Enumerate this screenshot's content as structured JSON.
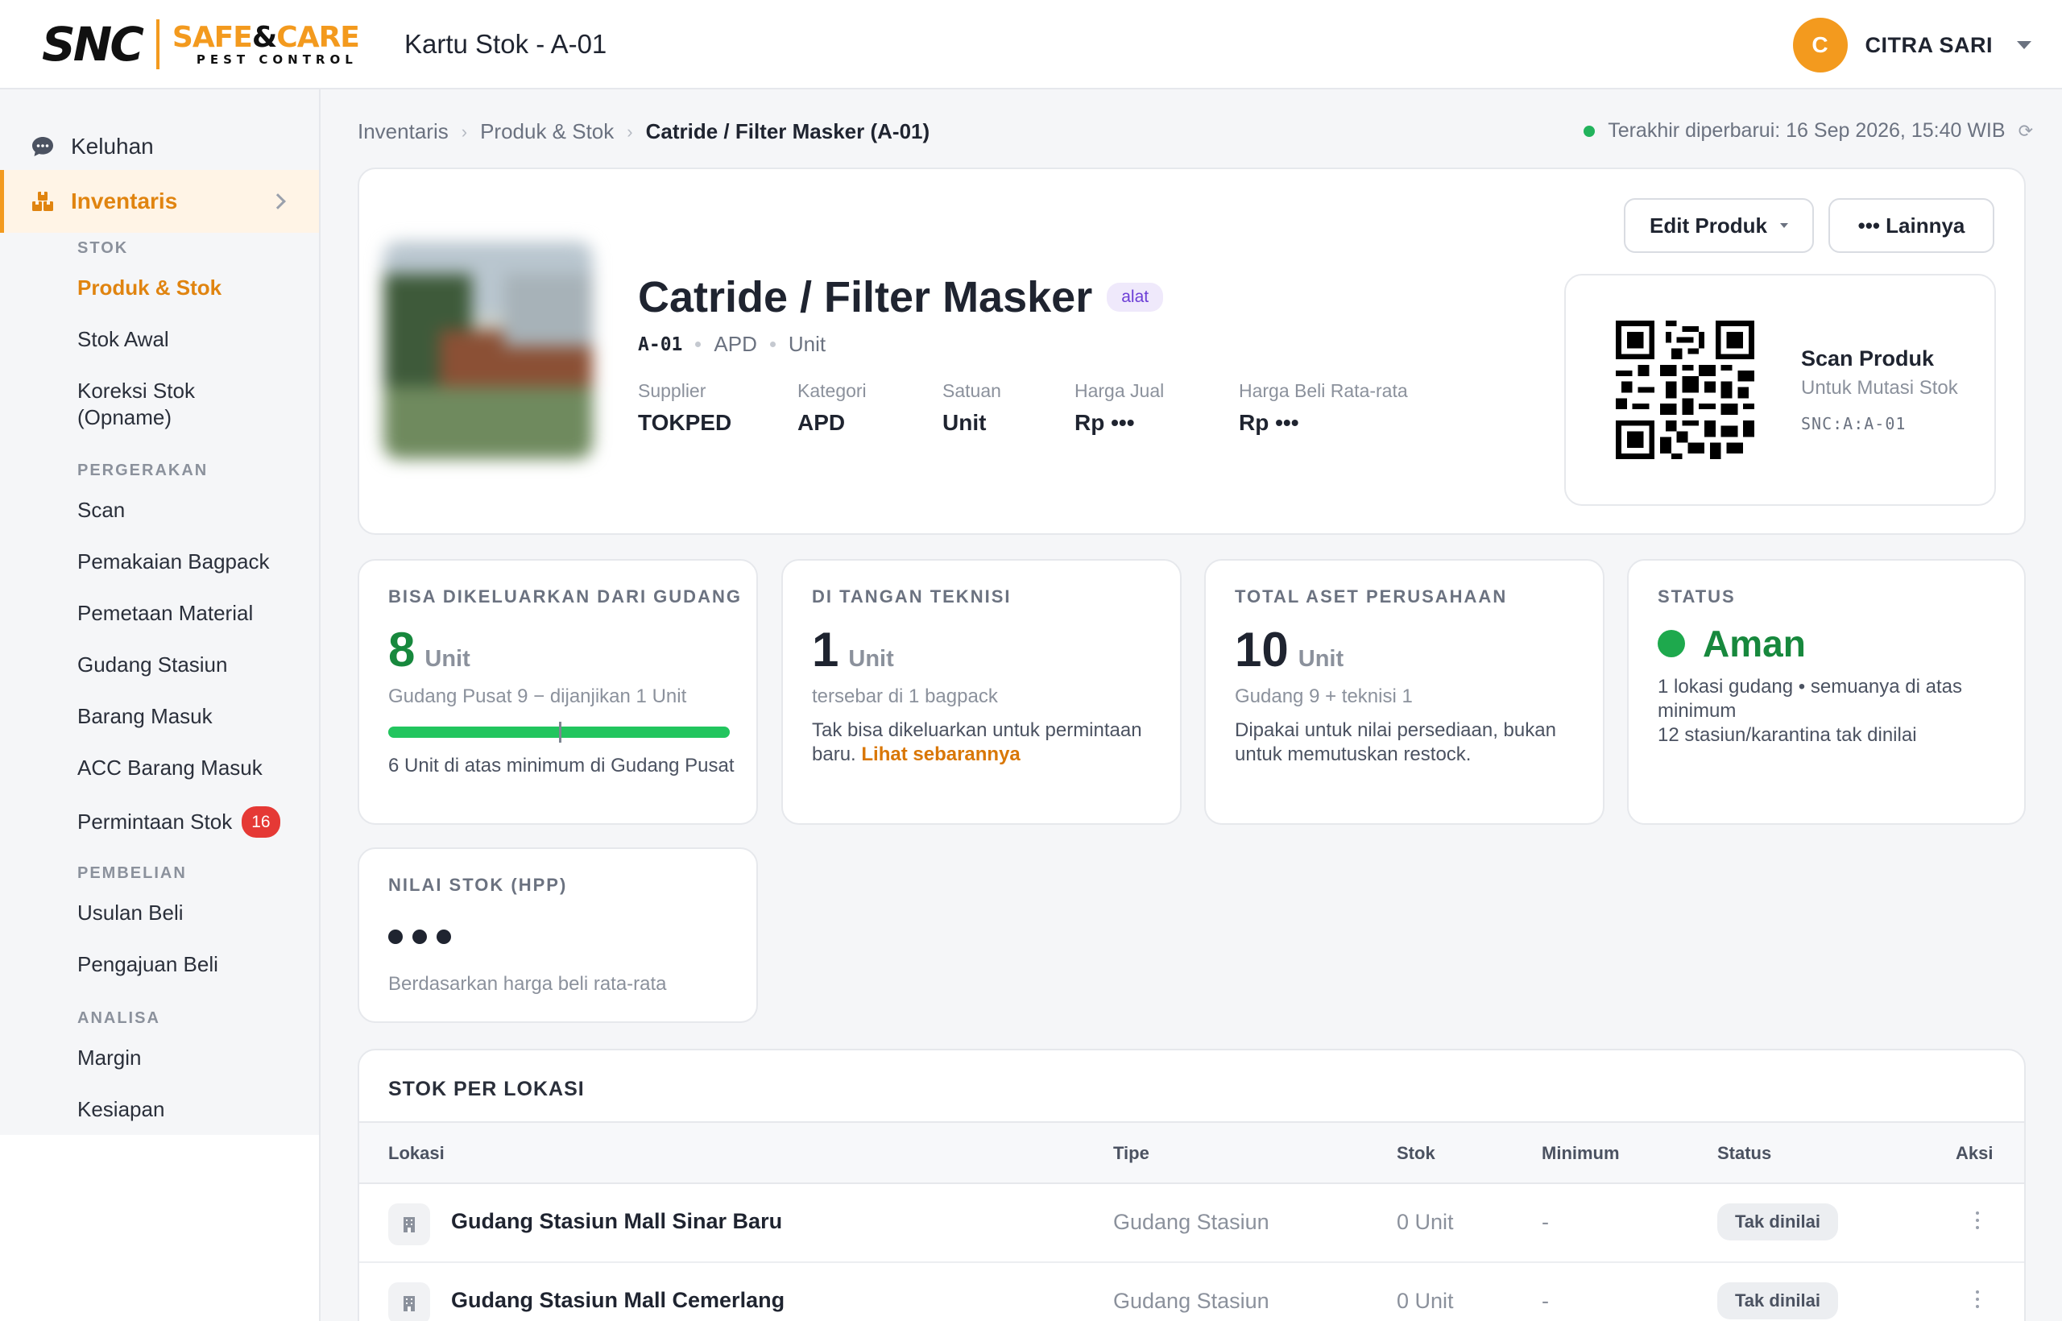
{
  "header": {
    "logo_snc": "SNC",
    "logo_brand_a": "SAFE",
    "logo_brand_amp": "&",
    "logo_brand_b": "CARE",
    "logo_tagline": "PEST CONTROL",
    "page_title": "Kartu Stok - A-01",
    "user_initial": "C",
    "user_name": "CITRA SARI"
  },
  "sidebar": {
    "top_items": [
      {
        "label": "Keluhan",
        "icon": "chat-bubble-icon"
      },
      {
        "label": "Inventaris",
        "icon": "boxes-icon"
      }
    ],
    "sections": [
      {
        "title": "STOK",
        "items": [
          "Produk & Stok",
          "Stok Awal",
          "Koreksi Stok (Opname)"
        ]
      },
      {
        "title": "PERGERAKAN",
        "items": [
          "Scan",
          "Pemakaian Bagpack",
          "Pemetaan Material",
          "Gudang Stasiun",
          "Barang Masuk",
          "ACC Barang Masuk",
          "Permintaan Stok"
        ]
      },
      {
        "title": "PEMBELIAN",
        "items": [
          "Usulan Beli",
          "Pengajuan Beli"
        ]
      },
      {
        "title": "ANALISA",
        "items": [
          "Margin",
          "Kesiapan"
        ]
      }
    ],
    "permintaan_badge": "16"
  },
  "breadcrumb": [
    "Inventaris",
    "Produk & Stok",
    "Catride / Filter Masker (A-01)"
  ],
  "updated_text": "Terakhir diperbarui: 16 Sep 2026, 15:40 WIB",
  "product": {
    "name": "Catride / Filter Masker",
    "tag": "alat",
    "code": "A-01",
    "category_short": "APD",
    "unit_short": "Unit",
    "fields": [
      {
        "label": "Supplier",
        "value": "TOKPED"
      },
      {
        "label": "Kategori",
        "value": "APD"
      },
      {
        "label": "Satuan",
        "value": "Unit"
      },
      {
        "label": "Harga Jual",
        "value": "Rp •••"
      },
      {
        "label": "Harga Beli Rata-rata",
        "value": "Rp •••"
      }
    ],
    "edit_button": "Edit Produk",
    "more_button": "••• Lainnya",
    "qr_title": "Scan Produk",
    "qr_subtitle": "Untuk Mutasi Stok",
    "qr_code_text": "SNC:A:A-01"
  },
  "stats": {
    "available": {
      "label": "BISA DIKELUARKAN DARI GUDANG",
      "value": "8",
      "unit": "Unit",
      "sub": "Gudang Pusat 9 − dijanjikan 1 Unit",
      "bar_fraction": 1.0,
      "min_marker_fraction": 0.5,
      "desc": "6 Unit di atas minimum di Gudang Pusat"
    },
    "technician": {
      "label": "DI TANGAN TEKNISI",
      "value": "1",
      "unit": "Unit",
      "sub": "tersebar di 1 bagpack",
      "desc": "Tak bisa dikeluarkan untuk permintaan baru.",
      "link": "Lihat sebarannya"
    },
    "total": {
      "label": "TOTAL ASET PERUSAHAAN",
      "value": "10",
      "unit": "Unit",
      "sub": "Gudang 9 + teknisi 1",
      "desc": "Dipakai untuk nilai persediaan, bukan untuk memutuskan restock."
    },
    "status": {
      "label": "STATUS",
      "value": "Aman",
      "line1": "1 lokasi gudang • semuanya di atas minimum",
      "line2": "12 stasiun/karantina tak dinilai"
    },
    "value": {
      "label": "NILAI STOK (HPP)",
      "sub": "Berdasarkan harga beli rata-rata"
    }
  },
  "stock_table": {
    "title": "STOK PER LOKASI",
    "columns": [
      "Lokasi",
      "Tipe",
      "Stok",
      "Minimum",
      "Status",
      "Aksi"
    ],
    "rows": [
      {
        "lokasi": "Gudang Stasiun Mall Sinar Baru",
        "tipe": "Gudang Stasiun",
        "stok": "0 Unit",
        "minimum": "-",
        "status": "Tak dinilai"
      },
      {
        "lokasi": "Gudang Stasiun Mall Cemerlang",
        "tipe": "Gudang Stasiun",
        "stok": "0 Unit",
        "minimum": "-",
        "status": "Tak dinilai"
      }
    ]
  },
  "colors": {
    "accent": "#f39a1e",
    "active_text": "#e08410",
    "ok_green": "#17883d",
    "bar_green": "#22c55e",
    "badge_red": "#e53935",
    "tag_purple": "#6d3fd6"
  }
}
